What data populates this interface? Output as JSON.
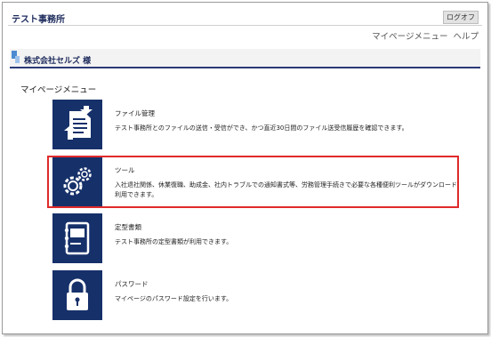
{
  "header": {
    "site_title": "テスト事務所",
    "logout_label": "ログオフ",
    "mypage_menu_link": "マイページメニュー",
    "help_link": "ヘルプ"
  },
  "company": {
    "name": "株式会社セルズ 様"
  },
  "section": {
    "title": "マイページメニュー"
  },
  "menu": [
    {
      "icon": "file-transfer-icon",
      "title": "ファイル管理",
      "description": "テスト事務所とのファイルの送信・受信ができ、かつ直近30日間のファイル送受信履歴を確認できます。"
    },
    {
      "icon": "gears-icon",
      "title": "ツール",
      "description": "入社退社関係、休業復職、助成金、社内トラブルでの通知書式等、労務管理手続きで必要な各種便利ツールがダウンロード利用できます。"
    },
    {
      "icon": "binder-icon",
      "title": "定型書類",
      "description": "テスト事務所の定型書類が利用できます。"
    },
    {
      "icon": "padlock-icon",
      "title": "パスワード",
      "description": "マイページのパスワード設定を行います。"
    }
  ],
  "colors": {
    "icon_bg": "#16306a",
    "bar_border": "#2b3a77",
    "highlight": "#e02a2a"
  }
}
